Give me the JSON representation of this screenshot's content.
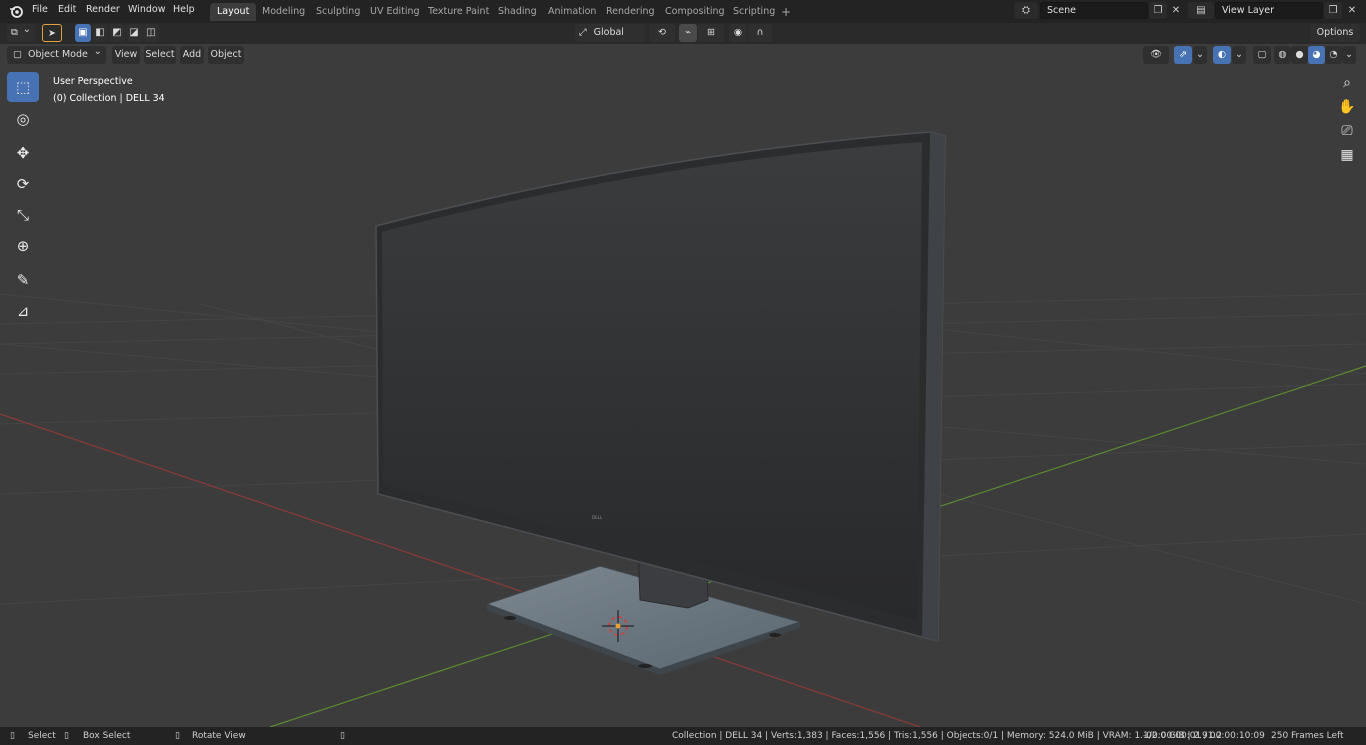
{
  "app": {
    "logo_icon": "blender-logo-icon",
    "menus": [
      "File",
      "Edit",
      "Render",
      "Window",
      "Help"
    ]
  },
  "workspaces": {
    "tabs": [
      "Layout",
      "Modeling",
      "Sculpting",
      "UV Editing",
      "Texture Paint",
      "Shading",
      "Animation",
      "Rendering",
      "Compositing",
      "Scripting"
    ],
    "active": "Layout",
    "add_icon": "plus-icon"
  },
  "scene": {
    "value": "Scene",
    "icon": "scene-icon"
  },
  "view_layer": {
    "value": "View Layer",
    "icon": "view-layer-icon"
  },
  "header": {
    "editor_type_icon": "3d-viewport-icon",
    "mode": "Object Mode",
    "menus": [
      "View",
      "Select",
      "Add",
      "Object"
    ],
    "transform_orientation": "Global",
    "options_label": "Options"
  },
  "viewport": {
    "perspective_label": "User Perspective",
    "collection_label": "(0) Collection | DELL 34",
    "brand_text": "DELL"
  },
  "tools": [
    {
      "name": "select-box-tool",
      "icon": "cursor-select-icon",
      "glyph": "⬚",
      "active": true
    },
    {
      "name": "cursor-tool",
      "icon": "3d-cursor-icon",
      "glyph": "◎",
      "active": false
    },
    {
      "name": "move-tool",
      "icon": "move-icon",
      "glyph": "✥",
      "active": false
    },
    {
      "name": "rotate-tool",
      "icon": "rotate-icon",
      "glyph": "⟳",
      "active": false
    },
    {
      "name": "scale-tool",
      "icon": "scale-icon",
      "glyph": "⤡",
      "active": false
    },
    {
      "name": "transform-tool",
      "icon": "transform-icon",
      "glyph": "⊕",
      "active": false
    },
    {
      "name": "annotate-tool",
      "icon": "annotate-icon",
      "glyph": "✎",
      "active": false
    },
    {
      "name": "measure-tool",
      "icon": "measure-icon",
      "glyph": "📐",
      "active": false
    }
  ],
  "nav_gizmo": [
    {
      "name": "zoom-icon",
      "glyph": "🔍"
    },
    {
      "name": "hand-pan-icon",
      "glyph": "✋"
    },
    {
      "name": "camera-view-icon",
      "glyph": "🎥"
    },
    {
      "name": "orthographic-grid-icon",
      "glyph": "▦"
    }
  ],
  "colors": {
    "accent": "#4772b3",
    "x_axis": "#8c3a3a",
    "y_axis": "#5c8a2e",
    "viewport_bg": "#3c3c3c"
  },
  "status": {
    "select": "Select",
    "box_select": "Box Select",
    "rotate_view": "Rotate View",
    "stats": "Collection | DELL 34 | Verts:1,383 | Faces:1,556 | Tris:1,556 | Objects:0/1 | Memory: 524.0 MiB | VRAM: 1.1/2.0 GiB | 2.91.2",
    "timecode": "-00:00:00:01 / 00:00:10:09",
    "frames_left": "250 Frames Left"
  }
}
